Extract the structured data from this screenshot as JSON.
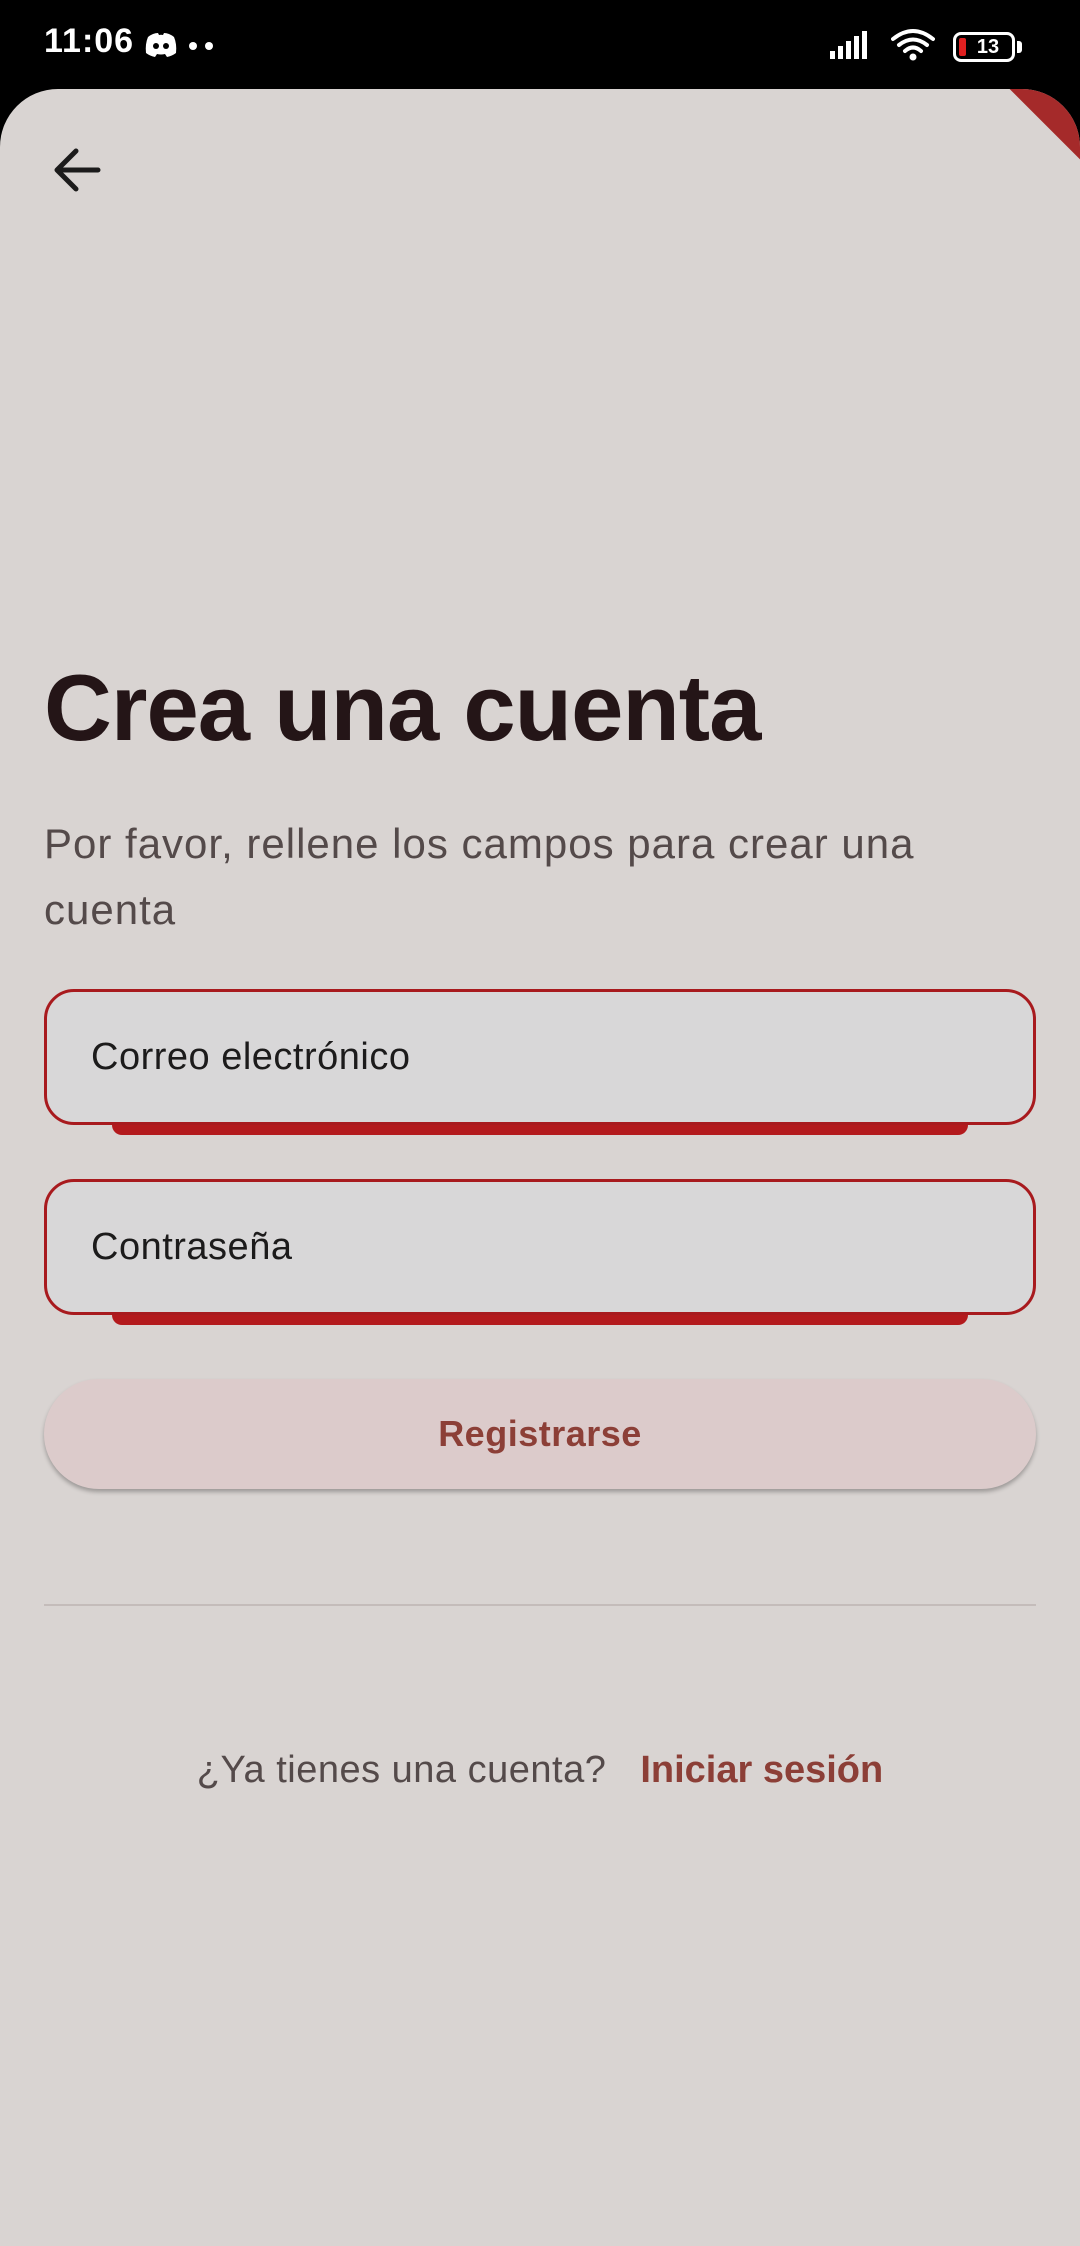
{
  "status_bar": {
    "time": "11:06",
    "left_icons": [
      "discord-icon",
      "notification-dot-icon",
      "notification-dot-icon"
    ],
    "right_icons": [
      "signal-icon",
      "wifi-icon",
      "battery-icon"
    ],
    "battery_level": "13",
    "battery_color": "#e02020"
  },
  "header": {
    "back_icon": "arrow-back-icon"
  },
  "main": {
    "title": "Crea una cuenta",
    "subtitle": "Por favor, rellene los campos para crear una cuenta",
    "email_field": {
      "placeholder": "Correo electrónico",
      "value": ""
    },
    "password_field": {
      "placeholder": "Contraseña",
      "value": ""
    },
    "register_button": "Registrarse",
    "signin_prompt": "¿Ya tienes una cuenta?",
    "signin_link": "Iniciar sesión"
  },
  "colors": {
    "background": "#d9d4d2",
    "accent": "#a81a1e",
    "button_text": "#8c3f37",
    "title_text": "#241517"
  }
}
